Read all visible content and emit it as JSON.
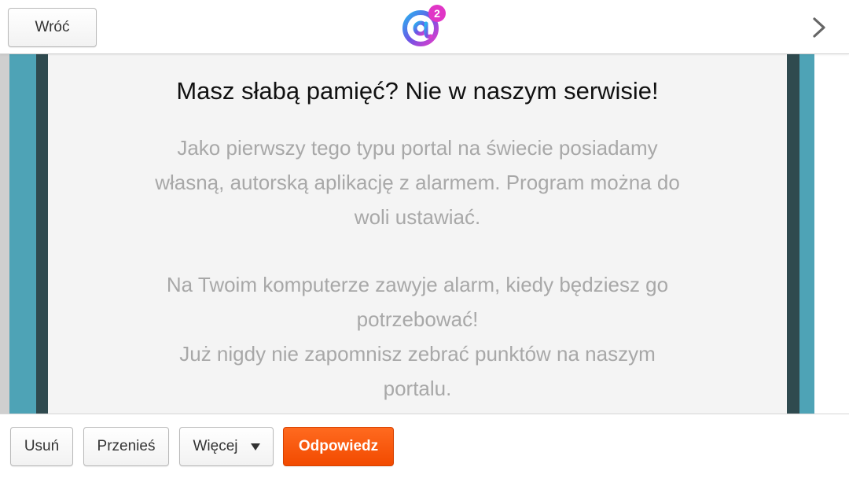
{
  "header": {
    "back_label": "Wróć",
    "logo_icon": "at-sign-squared-logo",
    "next_icon": "chevron-right-icon"
  },
  "message": {
    "title": "Masz słabą pamięć? Nie w naszym serwisie!",
    "paragraph1": [
      "Jako pierwszy tego typu portal na świecie posiadamy",
      "własną, autorską aplikację z alarmem. Program można do",
      "woli ustawiać."
    ],
    "paragraph2": [
      "Na Twoim komputerze zawyje alarm, kiedy będziesz go",
      "potrzebować!",
      "Już nigdy nie zapomnisz zebrać punktów na naszym",
      "portalu."
    ]
  },
  "toolbar": {
    "delete_label": "Usuń",
    "move_label": "Przenieś",
    "more_label": "Więcej",
    "reply_label": "Odpowiedz"
  },
  "colors": {
    "accent": "#f24a00",
    "teal": "#4ea3b6",
    "dark_teal": "#2f4a4f",
    "panel_bg": "#f4f4f4",
    "body_text": "#a8a8a8"
  }
}
